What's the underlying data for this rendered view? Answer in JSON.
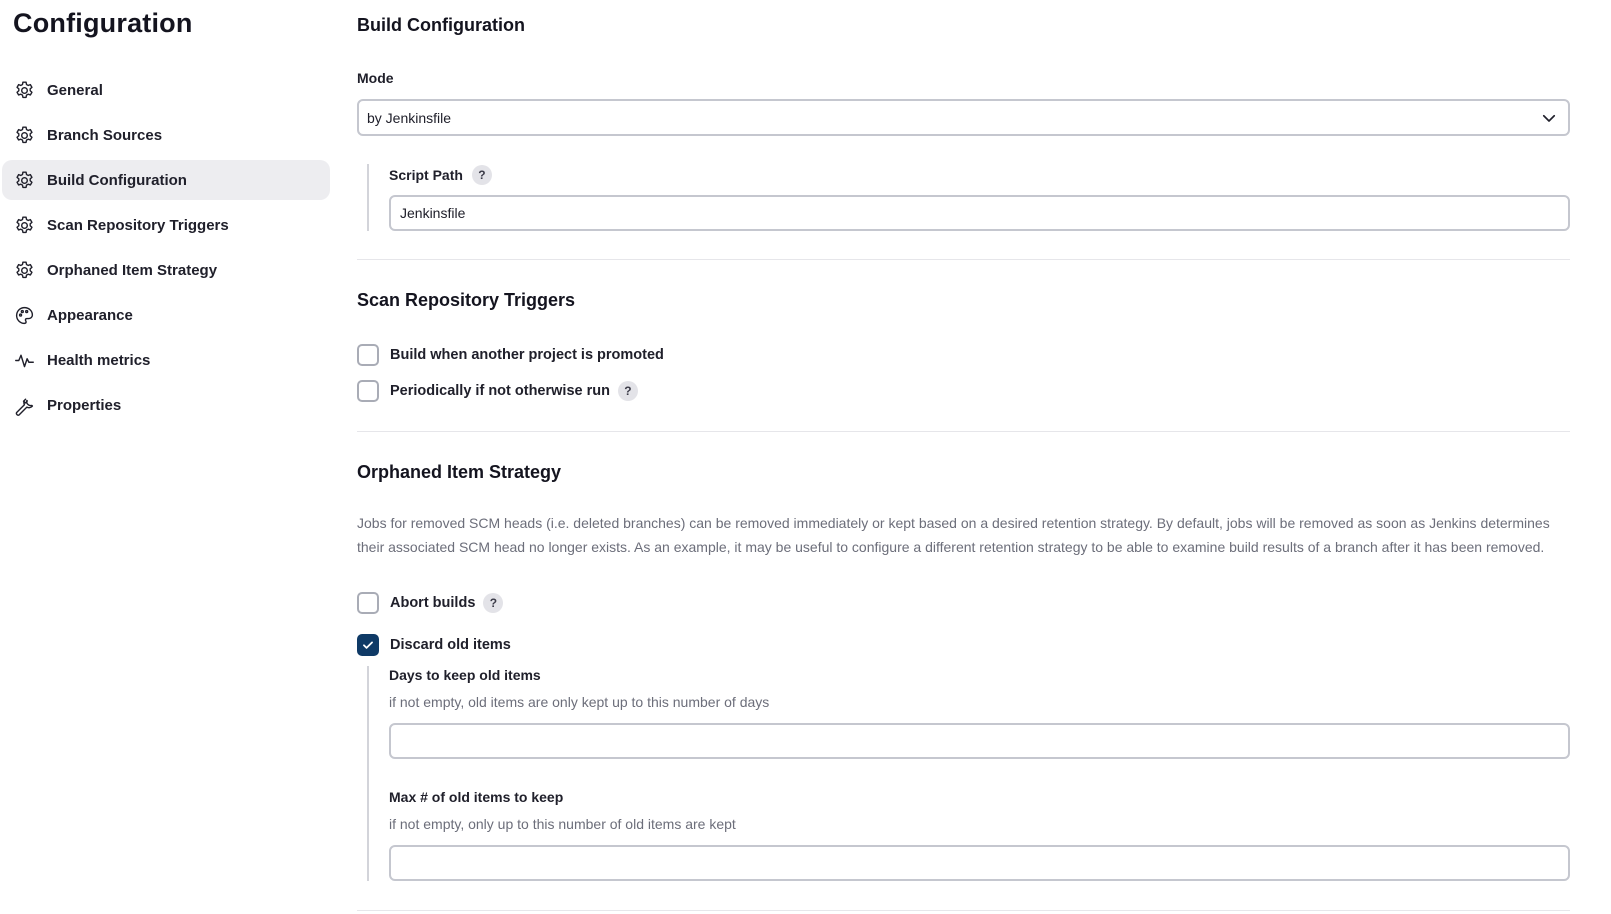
{
  "sidebar": {
    "title": "Configuration",
    "items": [
      {
        "label": "General",
        "icon": "gear-icon"
      },
      {
        "label": "Branch Sources",
        "icon": "gear-icon"
      },
      {
        "label": "Build Configuration",
        "icon": "gear-icon",
        "active": true
      },
      {
        "label": "Scan Repository Triggers",
        "icon": "gear-icon"
      },
      {
        "label": "Orphaned Item Strategy",
        "icon": "gear-icon"
      },
      {
        "label": "Appearance",
        "icon": "palette-icon"
      },
      {
        "label": "Health metrics",
        "icon": "pulse-icon"
      },
      {
        "label": "Properties",
        "icon": "wrench-icon"
      }
    ]
  },
  "build_configuration": {
    "title": "Build Configuration",
    "mode_label": "Mode",
    "mode_value": "by Jenkinsfile",
    "script_path_label": "Script Path",
    "script_path_value": "Jenkinsfile",
    "help_glyph": "?"
  },
  "scan_triggers": {
    "title": "Scan Repository Triggers",
    "options": [
      {
        "label": "Build when another project is promoted",
        "checked": false,
        "help": false
      },
      {
        "label": "Periodically if not otherwise run",
        "checked": false,
        "help": true
      }
    ]
  },
  "orphaned": {
    "title": "Orphaned Item Strategy",
    "description": "Jobs for removed SCM heads (i.e. deleted branches) can be removed immediately or kept based on a desired retention strategy. By default, jobs will be removed as soon as Jenkins determines their associated SCM head no longer exists. As an example, it may be useful to configure a different retention strategy to be able to examine build results of a branch after it has been removed.",
    "abort_builds_label": "Abort builds",
    "abort_builds_checked": false,
    "discard_label": "Discard old items",
    "discard_checked": true,
    "days_label": "Days to keep old items",
    "days_hint": "if not empty, old items are only kept up to this number of days",
    "days_value": "",
    "max_label": "Max # of old items to keep",
    "max_hint": "if not empty, only up to this number of old items are kept",
    "max_value": ""
  },
  "colors": {
    "active_bg": "#ededf0",
    "checkbox_checked": "#0f3a66",
    "border": "#c5c7cf"
  }
}
